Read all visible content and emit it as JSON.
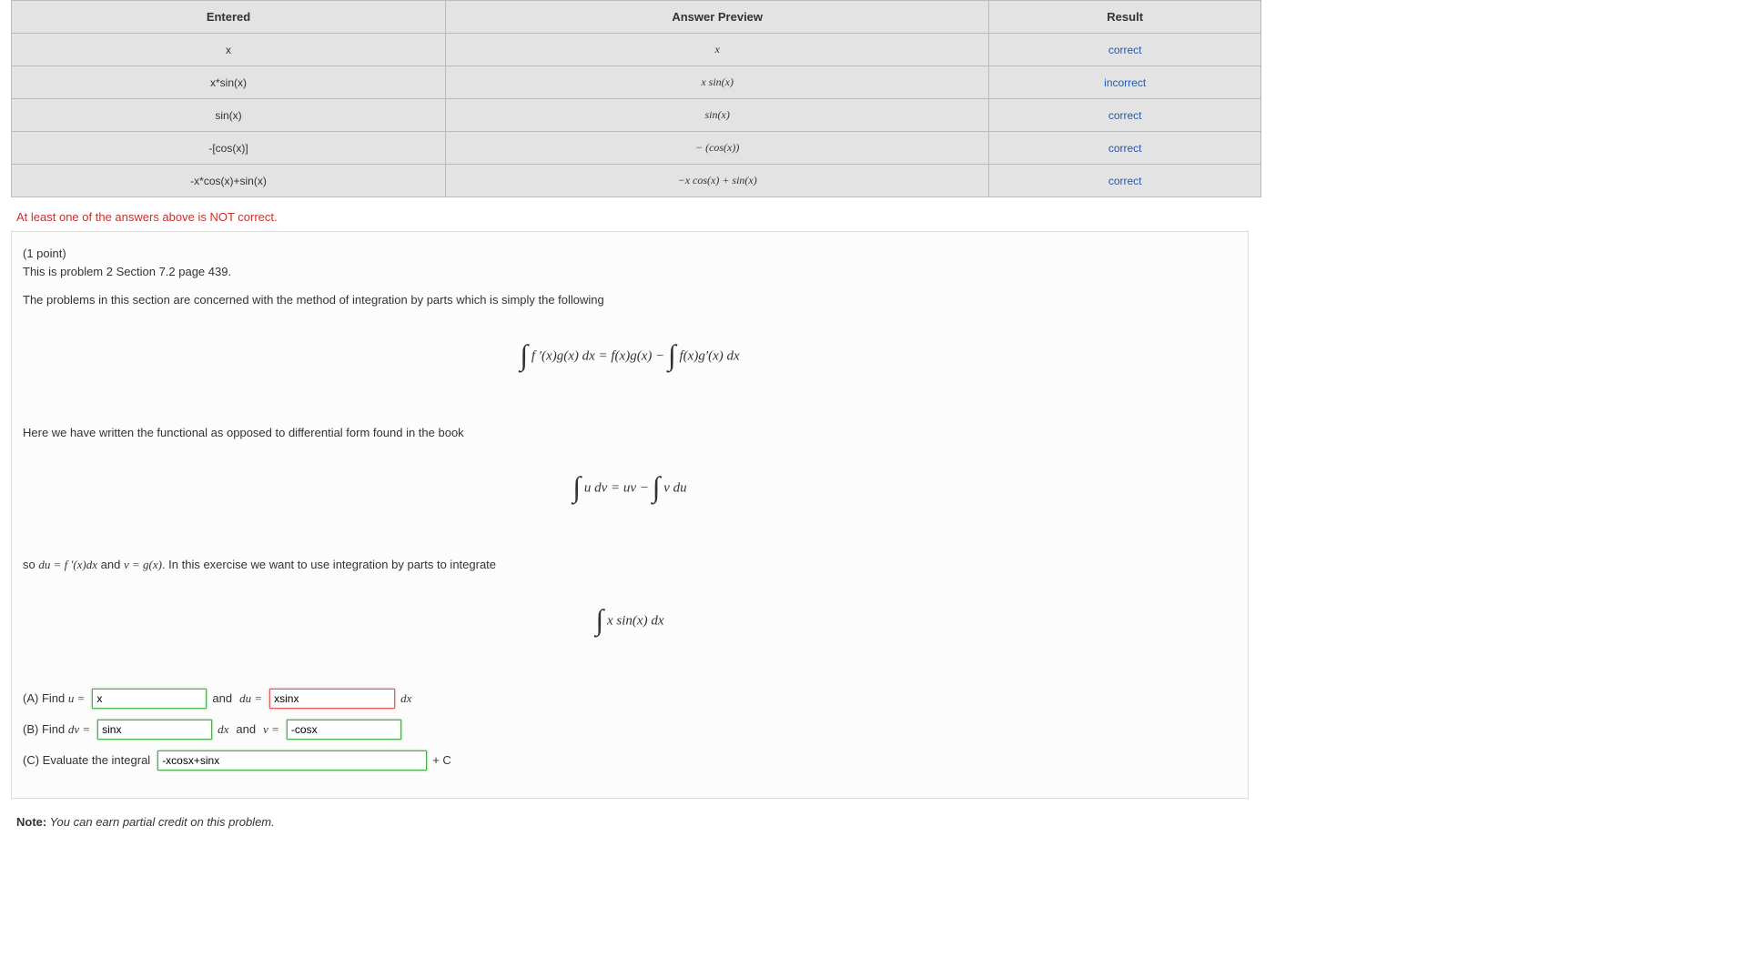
{
  "headers": {
    "entered": "Entered",
    "preview": "Answer Preview",
    "result": "Result"
  },
  "rows": [
    {
      "entered": "x",
      "preview": "x",
      "result": "correct",
      "status": "correct"
    },
    {
      "entered": "x*sin(x)",
      "preview": "x sin(x)",
      "result": "incorrect",
      "status": "incorrect"
    },
    {
      "entered": "sin(x)",
      "preview": "sin(x)",
      "result": "correct",
      "status": "correct"
    },
    {
      "entered": "-[cos(x)]",
      "preview": "− (cos(x))",
      "result": "correct",
      "status": "correct"
    },
    {
      "entered": "-x*cos(x)+sin(x)",
      "preview": "−x cos(x) + sin(x)",
      "result": "correct",
      "status": "correct"
    }
  ],
  "error_msg": "At least one of the answers above is NOT correct.",
  "problem": {
    "points": "(1 point)",
    "desc": "This is problem 2 Section 7.2 page 439.",
    "intro": "The problems in this section are concerned with the method of integration by parts which is simply the following",
    "eq1": "∫ f ′(x)g(x) dx = f(x)g(x) − ∫ f(x)g′(x) dx",
    "mid1": "Here we have written the functional as opposed to differential form found in the book",
    "eq2": "∫ u dv = uv − ∫ v du",
    "mid2_a": "so ",
    "mid2_b": "du = f ′(x)dx",
    "mid2_c": " and ",
    "mid2_d": "v = g(x)",
    "mid2_e": ". In this exercise we want to use integration by parts to integrate",
    "eq3": "∫ x sin(x) dx",
    "partA_label": "(A) Find ",
    "u_eq": "u =",
    "and": "and",
    "du_eq": "du =",
    "dx": "dx",
    "partB_label": "(B) Find ",
    "dv_eq": "dv =",
    "v_eq": "v =",
    "partC_label": "(C) Evaluate the integral",
    "plusC": "+ C",
    "inputs": {
      "u": {
        "value": "x",
        "status": "correct"
      },
      "du": {
        "value": "xsinx",
        "status": "incorrect"
      },
      "dv": {
        "value": "sinx",
        "status": "correct"
      },
      "v": {
        "value": "-cosx",
        "status": "correct"
      },
      "int": {
        "value": "-xcosx+sinx",
        "status": "correct"
      }
    }
  },
  "note": {
    "bold": "Note:",
    "text": " You can earn partial credit on this problem."
  }
}
